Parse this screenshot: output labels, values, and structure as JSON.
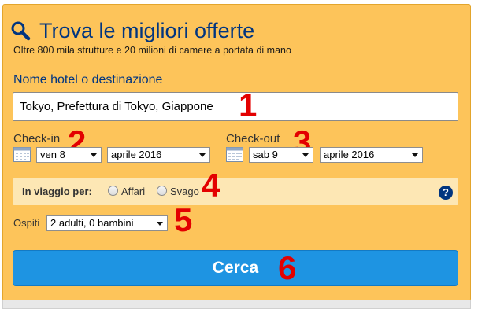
{
  "header": {
    "title": "Trova le migliori offerte",
    "subtitle": "Oltre 800 mila strutture e 20 milioni di camere a portata di mano",
    "icon": "search-icon"
  },
  "destination": {
    "label": "Nome hotel o destinazione",
    "value": "Tokyo, Prefettura di Tokyo, Giappone"
  },
  "checkin": {
    "label": "Check-in",
    "day": "ven 8",
    "month": "aprile 2016"
  },
  "checkout": {
    "label": "Check-out",
    "day": "sab 9",
    "month": "aprile 2016"
  },
  "travel": {
    "label": "In viaggio per:",
    "option_business": "Affari",
    "option_leisure": "Svago",
    "help": "?"
  },
  "guests": {
    "label": "Ospiti",
    "value": "2 adulti, 0 bambini"
  },
  "search_button": {
    "label": "Cerca"
  },
  "annotations": [
    "1",
    "2",
    "3",
    "4",
    "5",
    "6"
  ],
  "colors": {
    "panel_bg": "#fdc45a",
    "title_blue": "#003580",
    "button_blue": "#1e94e2",
    "annotation_red": "#e30000"
  }
}
